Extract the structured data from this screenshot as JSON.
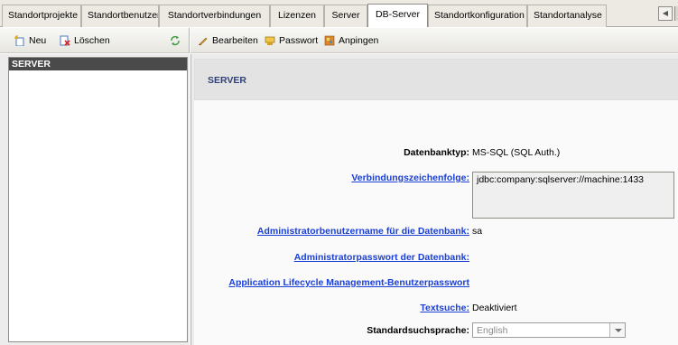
{
  "tabs": [
    {
      "label": "Standortprojekte"
    },
    {
      "label": "Standortbenutzer"
    },
    {
      "label": "Standortverbindungen"
    },
    {
      "label": "Lizenzen"
    },
    {
      "label": "Server"
    },
    {
      "label": "DB-Server",
      "active": true
    },
    {
      "label": "Standortkonfiguration"
    },
    {
      "label": "Standortanalyse"
    }
  ],
  "left_toolbar": {
    "new_label": "Neu",
    "delete_label": "Löschen"
  },
  "right_toolbar": {
    "edit_label": "Bearbeiten",
    "password_label": "Passwort",
    "ping_label": "Anpingen"
  },
  "server_list": {
    "items": [
      "SERVER"
    ]
  },
  "detail": {
    "header_title": "SERVER",
    "db_type_label": "Datenbanktyp:",
    "db_type_value": "MS-SQL (SQL Auth.)",
    "connection_label": "Verbindungszeichenfolge:",
    "connection_value": "jdbc:company:sqlserver://machine:1433",
    "admin_user_label": "Administratorbenutzername für die Datenbank:",
    "admin_user_value": "sa",
    "admin_password_label": "Administratorpasswort der Datenbank:",
    "alm_password_label": "Application Lifecycle Management-Benutzerpasswort",
    "text_search_label": "Textsuche:",
    "text_search_value": "Deaktiviert",
    "search_language_label": "Standardsuchsprache:",
    "search_language_value": "English"
  },
  "colors": {
    "accent_link": "#1a3fd6",
    "header_title": "#30417a",
    "list_selected": "#4a4a4a"
  }
}
